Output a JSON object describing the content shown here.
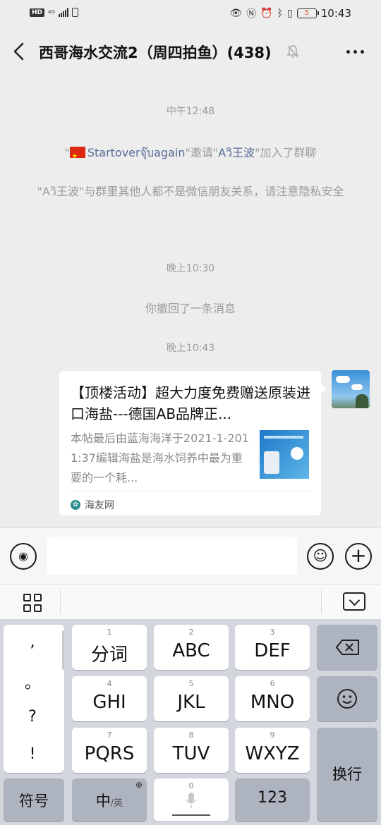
{
  "status": {
    "hd": "HD",
    "network": "4G",
    "battery": "5",
    "time": "10:43"
  },
  "header": {
    "title": "西哥海水交流2（周四拍鱼）(438)"
  },
  "chat": {
    "time1": "中午12:48",
    "invite": {
      "q1": "\"",
      "inviter": "Startoverจุ๊บagain",
      "mid": "\"邀请\"",
      "invitee": "Aวิ王波",
      "tail": "\"加入了群聊"
    },
    "privacy_notice": "\"Aวิ王波\"与群里其他人都不是微信朋友关系，请注意隐私安全",
    "time2": "晚上10:30",
    "recall_notice": "你撤回了一条消息",
    "time3": "晚上10:43",
    "card": {
      "title": "【顶楼活动】超大力度免费赠送原装进口海盐---德国AB品牌正...",
      "description": "本帖最后由蓝海海洋于2021-1-2011:37编辑海盐是海水饲养中最为重要的一个耗...",
      "source": "海友网"
    }
  },
  "keyboard": {
    "punct": [
      ",",
      "。",
      "?",
      "!"
    ],
    "rows": [
      {
        "num": "1",
        "label": "分词"
      },
      {
        "num": "2",
        "label": "ABC"
      },
      {
        "num": "3",
        "label": "DEF"
      },
      {
        "num": "4",
        "label": "GHI"
      },
      {
        "num": "5",
        "label": "JKL"
      },
      {
        "num": "6",
        "label": "MNO"
      },
      {
        "num": "7",
        "label": "PQRS"
      },
      {
        "num": "8",
        "label": "TUV"
      },
      {
        "num": "9",
        "label": "WXYZ"
      }
    ],
    "symbols": "符号",
    "lang_main": "中",
    "lang_sub": "/英",
    "space_num": "0",
    "num123": "123",
    "enter": "换行"
  }
}
